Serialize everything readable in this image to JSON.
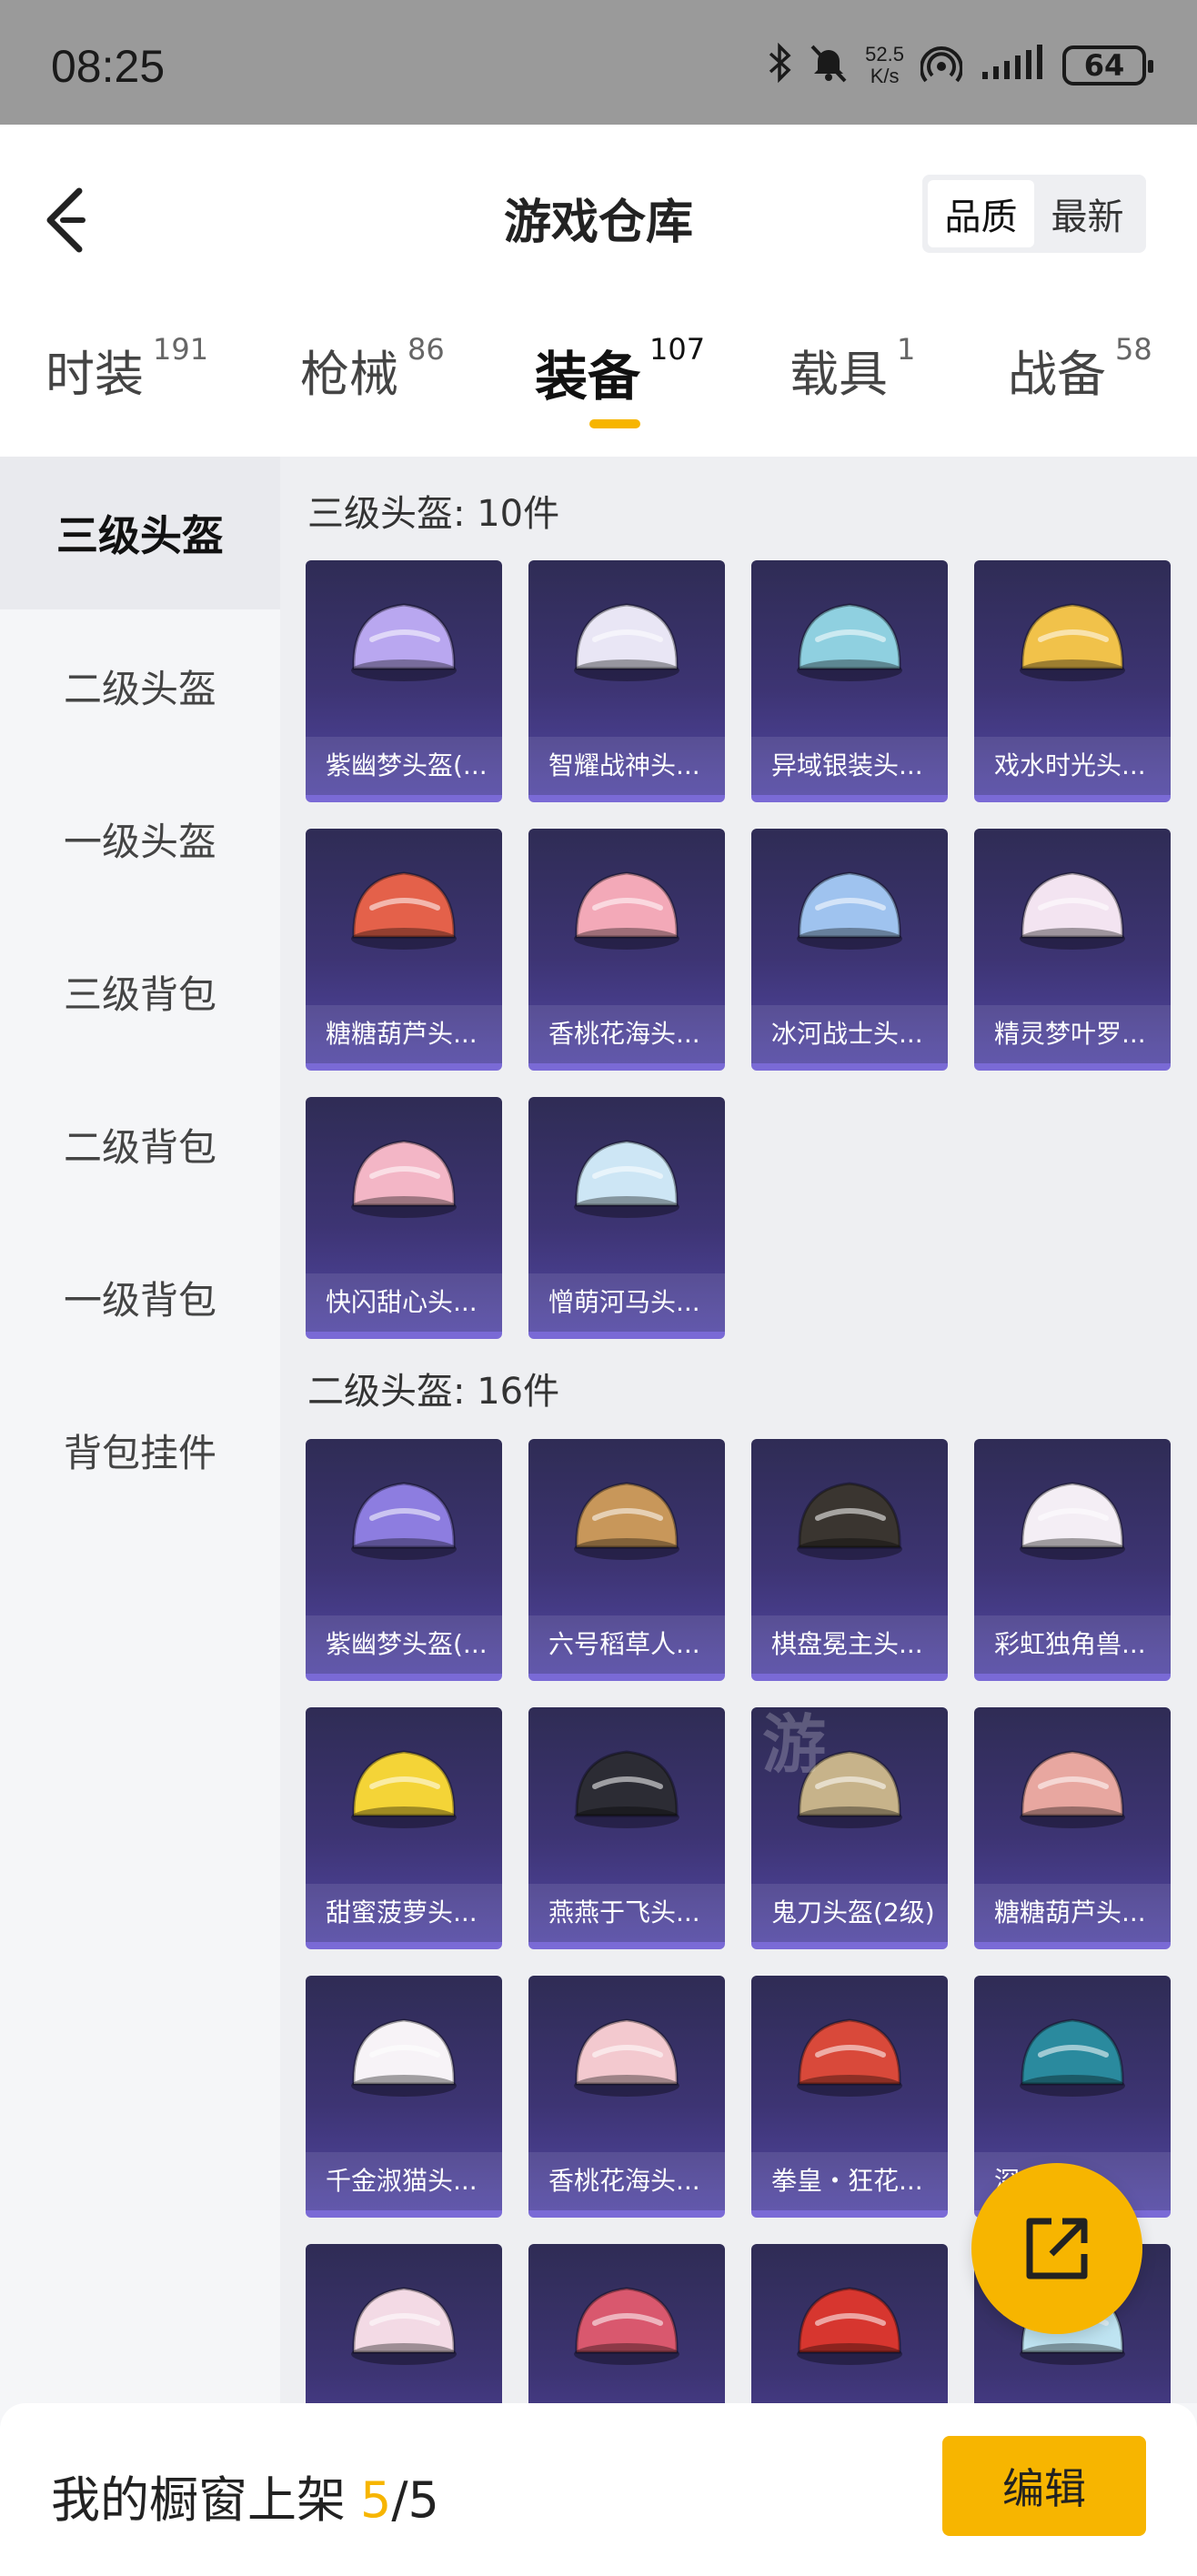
{
  "status_bar": {
    "time": "08:25",
    "net_speed_value": "52.5",
    "net_speed_unit": "K/s",
    "battery": "64",
    "icons": [
      "bluetooth-icon",
      "mute-icon",
      "hotspot-icon",
      "signal-icon",
      "battery-icon"
    ]
  },
  "header": {
    "title": "游戏仓库",
    "sort": {
      "options": [
        "品质",
        "最新"
      ],
      "selected": "品质"
    }
  },
  "tabs": [
    {
      "label": "时装",
      "count": "191",
      "active": false
    },
    {
      "label": "枪械",
      "count": "86",
      "active": false
    },
    {
      "label": "装备",
      "count": "107",
      "active": true
    },
    {
      "label": "载具",
      "count": "1",
      "active": false
    },
    {
      "label": "战备",
      "count": "58",
      "active": false
    }
  ],
  "sidebar": {
    "items": [
      "三级头盔",
      "二级头盔",
      "一级头盔",
      "三级背包",
      "二级背包",
      "一级背包",
      "背包挂件"
    ],
    "selected": "三级头盔"
  },
  "sections": [
    {
      "title": "三级头盔: 10件",
      "items": [
        "紫幽梦头盔(...",
        "智耀战神头...",
        "异域银装头...",
        "戏水时光头...",
        "糖糖葫芦头...",
        "香桃花海头...",
        "冰河战士头...",
        "精灵梦叶罗...",
        "快闪甜心头...",
        "憎萌河马头..."
      ]
    },
    {
      "title": "二级头盔: 16件",
      "items": [
        "紫幽梦头盔(...",
        "六号稻草人...",
        "棋盘冕主头...",
        "彩虹独角兽...",
        "甜蜜菠萝头...",
        "燕燕于飞头...",
        "鬼刀头盔(2级)",
        "糖糖葫芦头...",
        "千金淑猫头...",
        "香桃花海头...",
        "拳皇・狂花...",
        "深...角...",
        "",
        "",
        "",
        ""
      ]
    }
  ],
  "watermark": "游",
  "bottom_bar": {
    "label": "我的橱窗上架",
    "current": "5",
    "total": "/5",
    "edit_label": "编辑"
  },
  "colors": {
    "accent": "#f7b500",
    "card_top": "#2f2c55",
    "card_bottom": "#5146a3"
  }
}
